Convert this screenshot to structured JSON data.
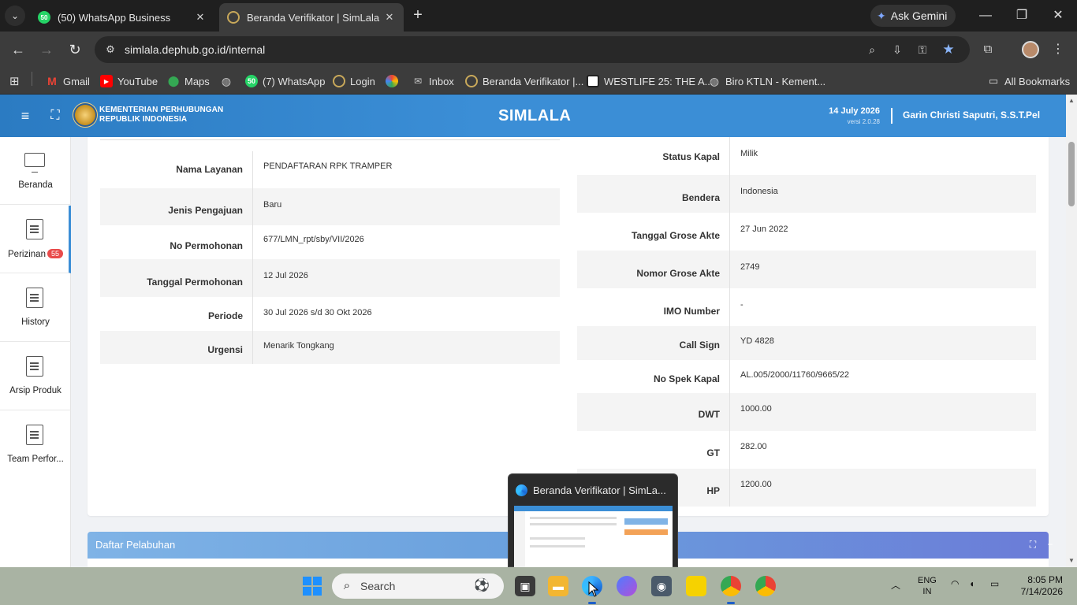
{
  "browser": {
    "tabs": [
      {
        "label": "(50) WhatsApp Business",
        "fav_text": "50"
      },
      {
        "label": "Beranda Verifikator | SimLala"
      }
    ],
    "new_tab": "+",
    "gemini_label": "Ask Gemini",
    "url": "simlala.dephub.go.id/internal",
    "bookmarks": [
      {
        "label": "Gmail",
        "color": "#ea4335"
      },
      {
        "label": "YouTube",
        "color": "#ff0000"
      },
      {
        "label": "Maps",
        "color": "#34a853"
      },
      {
        "label": "",
        "color": "#9aa0a6"
      },
      {
        "label": "(7) WhatsApp",
        "color": "#25d366",
        "fav_text": "50"
      },
      {
        "label": "Login",
        "color": "#c8a85a"
      },
      {
        "label": "",
        "color": "#fbbc04"
      },
      {
        "label": "Inbox",
        "color": "#9aa0a6"
      },
      {
        "label": "Beranda Verifikator |...",
        "color": "#c8a85a"
      },
      {
        "label": "WESTLIFE 25: THE A...",
        "color": "#ffffff"
      },
      {
        "label": "Biro KTLN - Kement...",
        "color": "#9aa0a6"
      }
    ],
    "all_bookmarks": "All Bookmarks"
  },
  "app": {
    "ministry_line1": "KEMENTERIAN PERHUBUNGAN",
    "ministry_line2": "REPUBLIK INDONESIA",
    "title": "SIMLALA",
    "date": "14 July 2026",
    "version": "versi 2.0.28",
    "user": "Garin Christi Saputri, S.S.T.Pel",
    "accent": "#3b8ed6"
  },
  "sidebar": {
    "items": [
      {
        "label": "Beranda"
      },
      {
        "label": "Perizinan",
        "badge": "55"
      },
      {
        "label": "History"
      },
      {
        "label": "Arsip Produk"
      },
      {
        "label": "Team Perfor..."
      }
    ]
  },
  "left_details": [
    {
      "key": "Nama Layanan",
      "value": "PENDAFTARAN RPK TRAMPER"
    },
    {
      "key": "Jenis Pengajuan",
      "value": "Baru"
    },
    {
      "key": "No Permohonan",
      "value": "677/LMN_rpt/sby/VII/2026"
    },
    {
      "key": "Tanggal Permohonan",
      "value": "12 Jul 2026"
    },
    {
      "key": "Periode",
      "value": "30 Jul 2026 s/d 30 Okt 2026"
    },
    {
      "key": "Urgensi",
      "value": "Menarik Tongkang"
    }
  ],
  "right_details": [
    {
      "key": "Status Kapal",
      "value": "Milik"
    },
    {
      "key": "Bendera",
      "value": "Indonesia"
    },
    {
      "key": "Tanggal Grose Akte",
      "value": "27 Jun 2022"
    },
    {
      "key": "Nomor Grose Akte",
      "value": "2749"
    },
    {
      "key": "IMO Number",
      "value": "-"
    },
    {
      "key": "Call Sign",
      "value": "YD 4828"
    },
    {
      "key": "No Spek Kapal",
      "value": "AL.005/2000/11760/9665/22"
    },
    {
      "key": "DWT",
      "value": "1000.00"
    },
    {
      "key": "GT",
      "value": "282.00"
    },
    {
      "key": "HP",
      "value": "1200.00"
    }
  ],
  "panel": {
    "title": "Daftar Pelabuhan"
  },
  "preview": {
    "title": "Beranda Verifikator | SimLa..."
  },
  "taskbar": {
    "search_placeholder": "Search",
    "lang_line1": "ENG",
    "lang_line2": "IN",
    "time": "8:05 PM",
    "date": "7/14/2026"
  }
}
